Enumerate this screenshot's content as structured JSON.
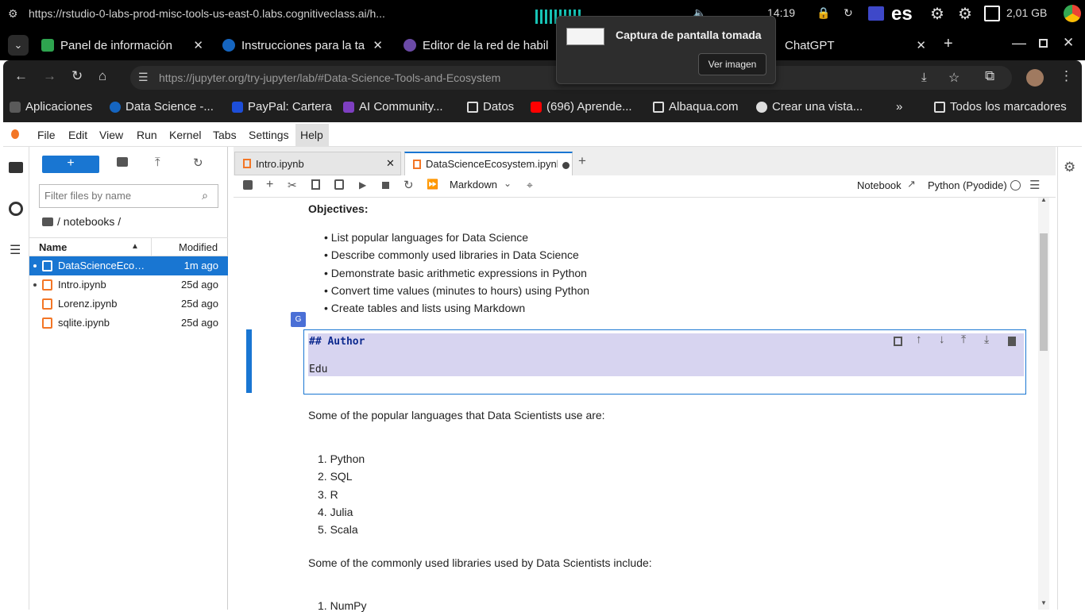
{
  "os": {
    "url": "https://rstudio-0-labs-prod-misc-tools-us-east-0.labs.cognitiveclass.ai/h...",
    "time": "14:19",
    "lang": "es",
    "storage": "2,01 GB",
    "battery_badge": "..."
  },
  "tabs": [
    {
      "label": "Panel de información",
      "color": "#2ea44f"
    },
    {
      "label": "Instrucciones para la ta",
      "color": "#1565c0"
    },
    {
      "label": "Editor de la red de habil",
      "color": "#6b4aa6"
    },
    {
      "label": "ChatGPT",
      "color": "#e0e0e0"
    }
  ],
  "address": {
    "url": "https://jupyter.org/try-jupyter/lab/#Data-Science-Tools-and-Ecosystem"
  },
  "bookmarks": [
    {
      "label": "Aplicaciones"
    },
    {
      "label": "Data Science -..."
    },
    {
      "label": "PayPal: Cartera"
    },
    {
      "label": "AI Community..."
    },
    {
      "label": "Datos"
    },
    {
      "label": "(696) Aprende..."
    },
    {
      "label": "Albaqua.com"
    },
    {
      "label": "Crear una vista..."
    },
    {
      "label": "Todos los marcadores"
    }
  ],
  "notification": {
    "title": "Captura de pantalla tomada",
    "button": "Ver imagen"
  },
  "menu": [
    "File",
    "Edit",
    "View",
    "Run",
    "Kernel",
    "Tabs",
    "Settings",
    "Help"
  ],
  "filebrowser": {
    "filter_placeholder": "Filter files by name",
    "path": "/ notebooks /",
    "col_name": "Name",
    "col_modified": "Modified",
    "files": [
      {
        "name": "DataScienceEcos...",
        "modified": "1m ago"
      },
      {
        "name": "Intro.ipynb",
        "modified": "25d ago"
      },
      {
        "name": "Lorenz.ipynb",
        "modified": "25d ago"
      },
      {
        "name": "sqlite.ipynb",
        "modified": "25d ago"
      }
    ]
  },
  "nbtabs": [
    {
      "label": "Intro.ipynb"
    },
    {
      "label": "DataScienceEcosystem.ipynl"
    }
  ],
  "toolbar": {
    "celltype": "Markdown",
    "notebook": "Notebook",
    "kernel": "Python (Pyodide)"
  },
  "content": {
    "objectives_heading": "Objectives:",
    "objectives": [
      "List popular languages for Data Science",
      "Describe commonly used libraries in Data Science",
      "Demonstrate basic arithmetic expressions in Python",
      "Convert time values (minutes to hours) using Python",
      "Create tables and lists using Markdown"
    ],
    "cell_line1": "## Author",
    "cell_line2": "Edu",
    "languages_intro": "Some of the popular languages that Data Scientists use are:",
    "languages": [
      "Python",
      "SQL",
      "R",
      "Julia",
      "Scala"
    ],
    "libraries_intro": "Some of the commonly used libraries used by Data Scientists include:",
    "libraries_first": "NumPy"
  }
}
